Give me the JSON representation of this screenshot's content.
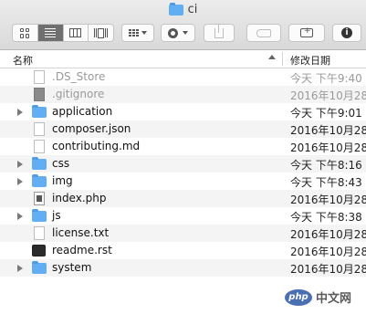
{
  "window": {
    "title": "ci"
  },
  "toolbar": {
    "view_buttons": [
      "icon-view",
      "list-view",
      "column-view",
      "cover-flow-view"
    ],
    "arrange_icon": "arrange-icon",
    "action_icon": "gear-icon",
    "share_icon": "share-icon",
    "tag_icon": "tag-icon",
    "new_folder_icon": "new-folder-icon",
    "info_icon": "info-icon",
    "info_glyph": "i"
  },
  "list": {
    "columns": {
      "name": "名称",
      "date": "修改日期"
    },
    "rows": [
      {
        "name": ".DS_Store",
        "date": "今天 下午9:40",
        "icon": "document-icon",
        "expandable": false,
        "dim": true
      },
      {
        "name": ".gitignore",
        "date": "2016年10月28",
        "icon": "gray-document-icon",
        "expandable": false,
        "dim": true
      },
      {
        "name": "application",
        "date": "今天 下午9:01",
        "icon": "folder-icon",
        "expandable": true,
        "dim": false
      },
      {
        "name": "composer.json",
        "date": "2016年10月28",
        "icon": "document-icon",
        "expandable": false,
        "dim": false
      },
      {
        "name": "contributing.md",
        "date": "2016年10月28",
        "icon": "document-icon",
        "expandable": false,
        "dim": false
      },
      {
        "name": "css",
        "date": "今天 下午8:16",
        "icon": "folder-icon",
        "expandable": true,
        "dim": false
      },
      {
        "name": "img",
        "date": "今天 下午8:43",
        "icon": "folder-icon",
        "expandable": true,
        "dim": false
      },
      {
        "name": "index.php",
        "date": "2016年10月28",
        "icon": "php-file-icon",
        "expandable": false,
        "dim": false
      },
      {
        "name": "js",
        "date": "今天 下午8:38",
        "icon": "folder-icon",
        "expandable": true,
        "dim": false
      },
      {
        "name": "license.txt",
        "date": "2016年10月28",
        "icon": "document-icon",
        "expandable": false,
        "dim": false
      },
      {
        "name": "readme.rst",
        "date": "2016年10月28",
        "icon": "terminal-file-icon",
        "expandable": false,
        "dim": false
      },
      {
        "name": "system",
        "date": "2016年10月28",
        "icon": "folder-icon",
        "expandable": true,
        "dim": false
      }
    ]
  },
  "watermark": {
    "badge": "php",
    "text": "中文网"
  },
  "colors": {
    "folder": "#62aef2",
    "active_view": "#6f6f6f",
    "row_alt": "#f4f4f4",
    "watermark": "#4a6fb3"
  }
}
